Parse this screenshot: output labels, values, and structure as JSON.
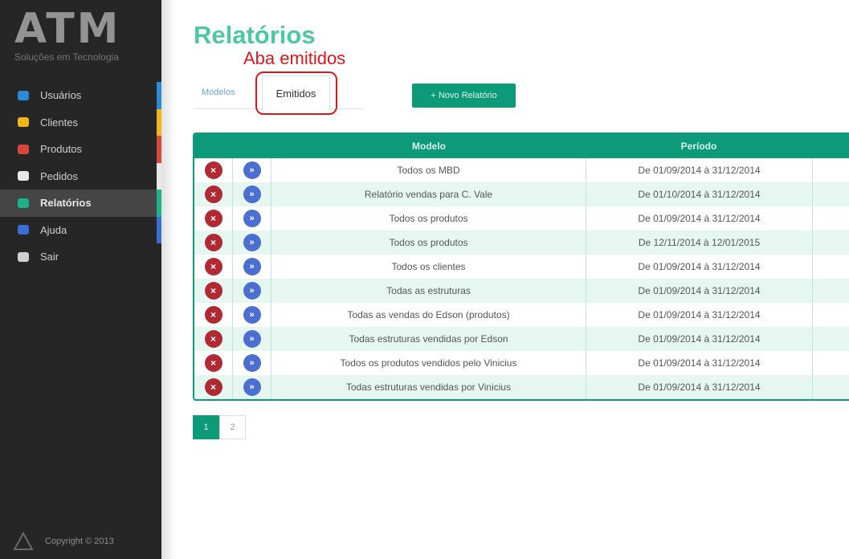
{
  "brand": {
    "logo": "ATM",
    "tagline": "Soluções em Tecnologia"
  },
  "sidebar": {
    "items": [
      {
        "label": "Usuários",
        "icon": "users-icon",
        "color": "#2a8bd9",
        "accent": "#2a8bd9",
        "active": false
      },
      {
        "label": "Clientes",
        "icon": "envelope-icon",
        "color": "#f2b51c",
        "accent": "#f2b51c",
        "active": false
      },
      {
        "label": "Produtos",
        "icon": "box-icon",
        "color": "#d9473a",
        "accent": "#d9473a",
        "active": false
      },
      {
        "label": "Pedidos",
        "icon": "document-icon",
        "color": "#e8e8e8",
        "accent": "#e8e8e8",
        "active": false
      },
      {
        "label": "Relatórios",
        "icon": "chart-icon",
        "color": "#1bb38a",
        "accent": "#1bb38a",
        "active": true
      },
      {
        "label": "Ajuda",
        "icon": "help-icon",
        "color": "#3b6fd6",
        "accent": "#3b6fd6",
        "active": false
      },
      {
        "label": "Sair",
        "icon": "exit-icon",
        "color": "#cfcfcf",
        "accent": "",
        "active": false
      }
    ],
    "copyright": "Copyright © 2013"
  },
  "page": {
    "title": "Relatórios",
    "annotation": "Aba emitidos",
    "tabs": {
      "modelos": "Modelos",
      "emitidos": "Emitidos"
    },
    "new_report_button": "+ Novo Relatório"
  },
  "table": {
    "headers": {
      "modelo": "Modelo",
      "periodo": "Período"
    },
    "rows": [
      {
        "modelo": "Todos os MBD",
        "periodo": "De 01/09/2014 à 31/12/2014"
      },
      {
        "modelo": "Relatório vendas para C. Vale",
        "periodo": "De 01/10/2014 à 31/12/2014"
      },
      {
        "modelo": "Todos os produtos",
        "periodo": "De 01/09/2014 à 31/12/2014"
      },
      {
        "modelo": "Todos os produtos",
        "periodo": "De 12/11/2014 à 12/01/2015"
      },
      {
        "modelo": "Todos os clientes",
        "periodo": "De 01/09/2014 à 31/12/2014"
      },
      {
        "modelo": "Todas as estruturas",
        "periodo": "De 01/09/2014 à 31/12/2014"
      },
      {
        "modelo": "Todas as vendas do Edson (produtos)",
        "periodo": "De 01/09/2014 à 31/12/2014"
      },
      {
        "modelo": "Todas estruturas vendidas por Edson",
        "periodo": "De 01/09/2014 à 31/12/2014"
      },
      {
        "modelo": "Todos os produtos vendidos pelo Vinicius",
        "periodo": "De 01/09/2014 à 31/12/2014"
      },
      {
        "modelo": "Todas estruturas vendidas por Vinicius",
        "periodo": "De 01/09/2014 à 31/12/2014"
      }
    ]
  },
  "pagination": {
    "pages": [
      "1",
      "2"
    ],
    "current": "1"
  }
}
